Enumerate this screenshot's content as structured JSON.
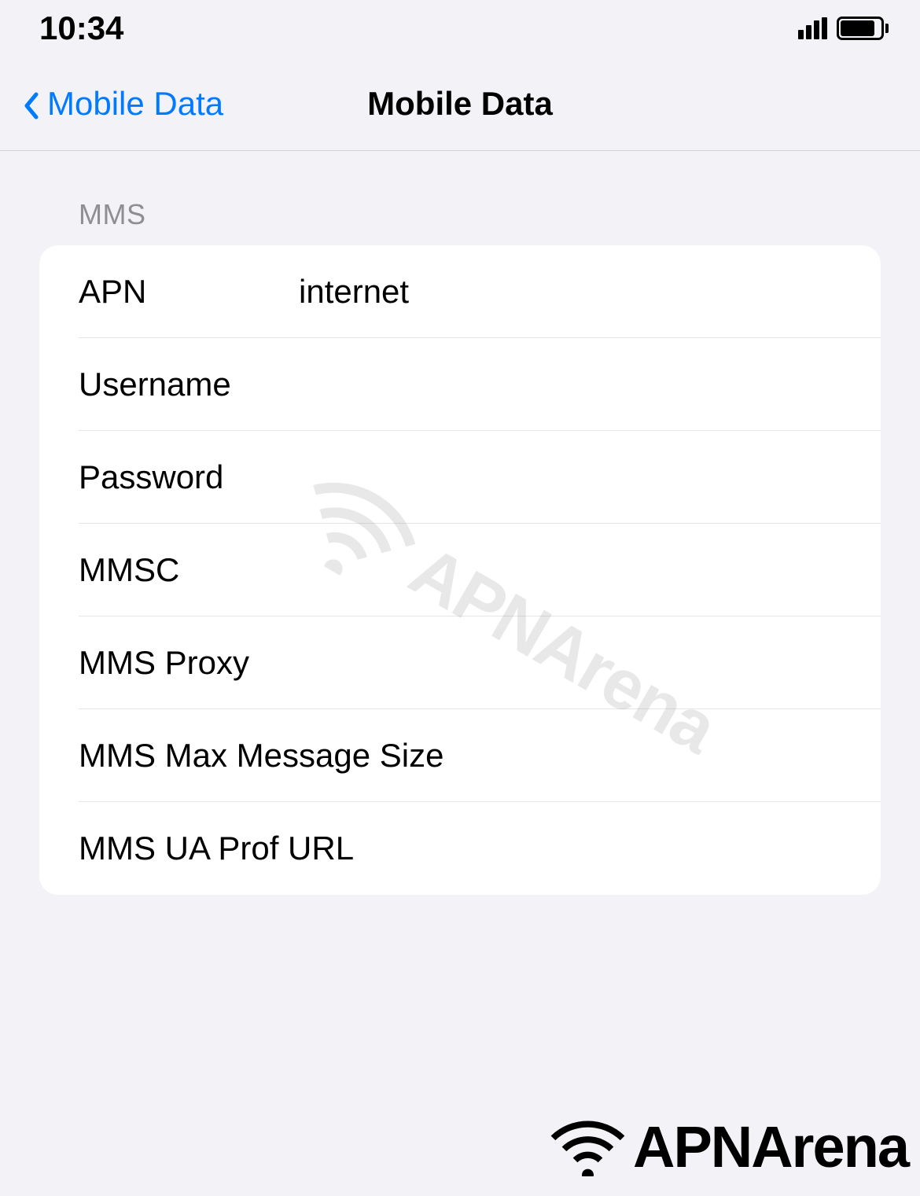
{
  "status_bar": {
    "time": "10:34"
  },
  "nav": {
    "back_label": "Mobile Data",
    "title": "Mobile Data"
  },
  "section_header": "MMS",
  "fields": {
    "apn": {
      "label": "APN",
      "value": "internet"
    },
    "username": {
      "label": "Username",
      "value": ""
    },
    "password": {
      "label": "Password",
      "value": ""
    },
    "mmsc": {
      "label": "MMSC",
      "value": ""
    },
    "mms_proxy": {
      "label": "MMS Proxy",
      "value": ""
    },
    "mms_max_size": {
      "label": "MMS Max Message Size",
      "value": ""
    },
    "mms_ua_prof": {
      "label": "MMS UA Prof URL",
      "value": ""
    }
  },
  "watermark": "APNArena"
}
